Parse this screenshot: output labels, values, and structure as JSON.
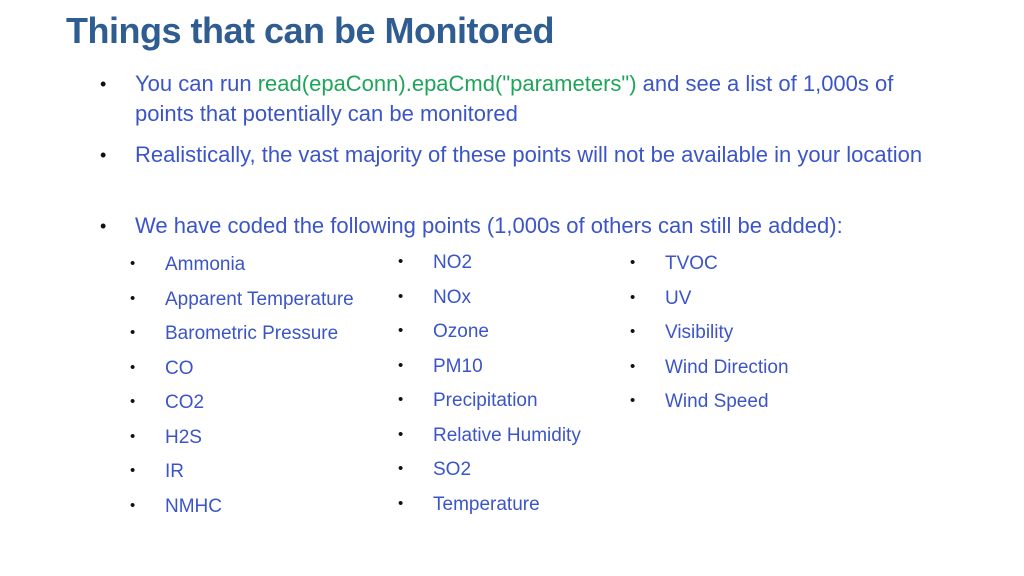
{
  "title": "Things that can be Monitored",
  "bullets": [
    {
      "pre": "You can run ",
      "code": "read(epaConn).epaCmd(\"parameters\")",
      "post": " and see a list of 1,000s of points that potentially can be monitored"
    },
    {
      "text": "Realistically, the vast majority of these points will not be available in your location"
    },
    {
      "text": "We have coded the following points (1,000s of others can still be added):"
    }
  ],
  "bullet_glyph": "•",
  "points": {
    "column1": [
      "Ammonia",
      "Apparent Temperature",
      "Barometric Pressure",
      "CO",
      "CO2",
      "H2S",
      "IR",
      "NMHC"
    ],
    "column2": [
      "NO2",
      "NOx",
      "Ozone",
      "PM10",
      "Precipitation",
      "Relative Humidity",
      "SO2",
      "Temperature"
    ],
    "column3": [
      "TVOC",
      "UV",
      "Visibility",
      "Wind Direction",
      "Wind Speed"
    ]
  },
  "colors": {
    "title": "#2f5d91",
    "body": "#3b55c8",
    "code": "#1fa55a"
  }
}
